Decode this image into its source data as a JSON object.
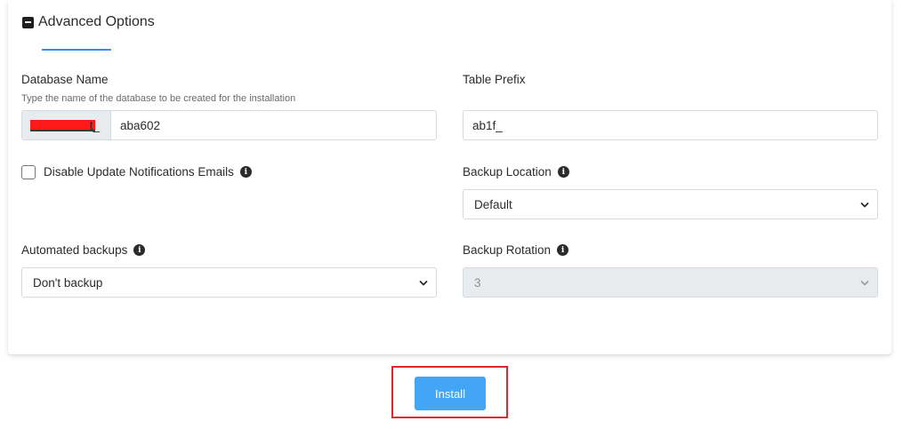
{
  "section": {
    "title": "Advanced Options",
    "toggle_icon": "minus-square-icon"
  },
  "database": {
    "label": "Database Name",
    "hint": "Type the name of the database to be created for the installation",
    "prefix_suffix": "t_",
    "value": "aba602"
  },
  "table_prefix": {
    "label": "Table Prefix",
    "value": "ab1f_"
  },
  "disable_notifications": {
    "label": "Disable Update Notifications Emails",
    "checked": false
  },
  "backup_location": {
    "label": "Backup Location",
    "selected": "Default"
  },
  "automated_backups": {
    "label": "Automated backups",
    "selected": "Don't backup"
  },
  "backup_rotation": {
    "label": "Backup Rotation",
    "selected": "3",
    "disabled": true
  },
  "install_button": {
    "label": "Install"
  },
  "colors": {
    "accent": "#3d8fe3",
    "button": "#42a5f5",
    "highlight": "#e0262a",
    "redaction": "#ff1a1a"
  }
}
